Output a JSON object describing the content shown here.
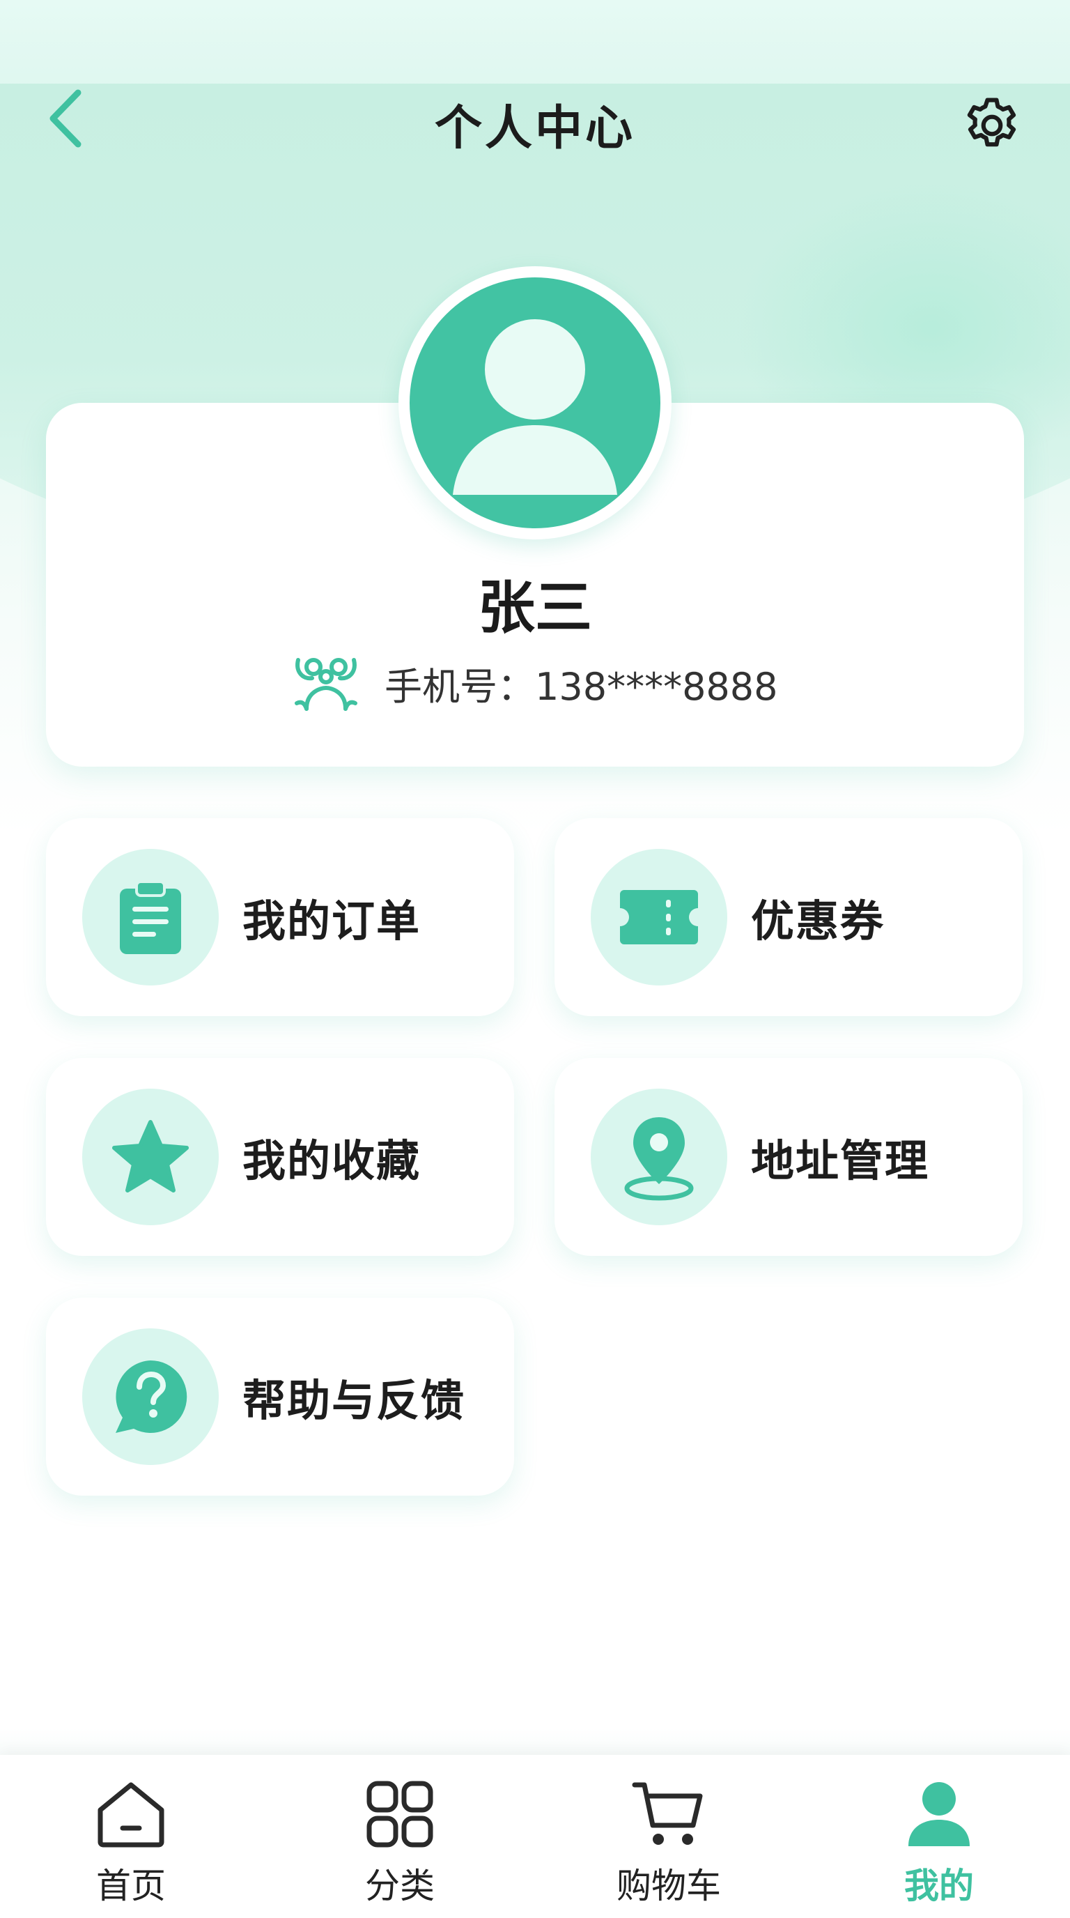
{
  "header": {
    "title": "个人中心",
    "back_icon": "chevron-left-icon",
    "settings_icon": "gear-icon"
  },
  "profile": {
    "name": "张三",
    "phone_label": "手机号：138****8888",
    "avatar_icon": "user-avatar-icon",
    "badge_icon": "member-badge-icon"
  },
  "menu": {
    "orders": "我的订单",
    "coupons": "优惠券",
    "favorites": "我的收藏",
    "address": "地址管理",
    "help": "帮助与反馈"
  },
  "tabbar": {
    "home": "首页",
    "category": "分类",
    "cart": "购物车",
    "mine": "我的",
    "active": "mine"
  },
  "colors": {
    "accent": "#42c3a3",
    "accent_light": "#d9f6ee",
    "text": "#1d1d1d"
  }
}
